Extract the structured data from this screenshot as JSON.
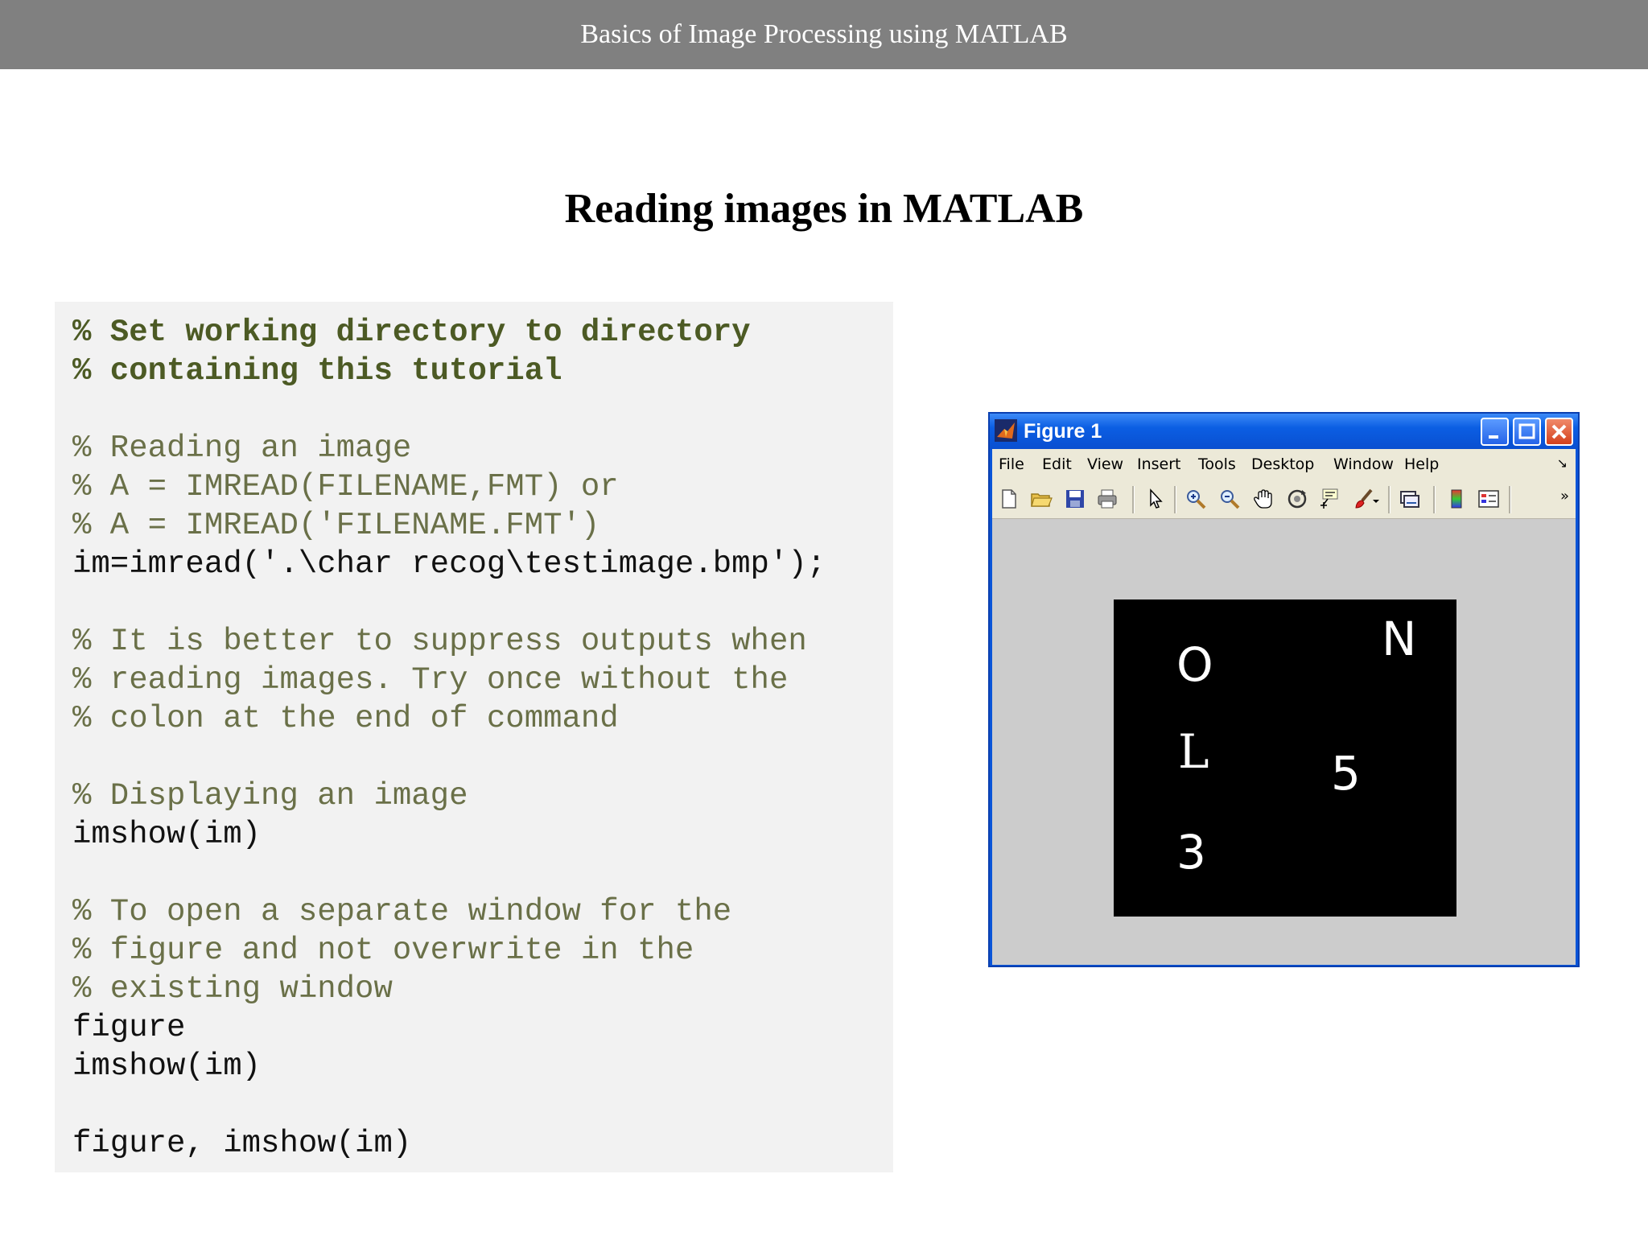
{
  "header": {
    "title": "Basics of Image Processing using MATLAB"
  },
  "slide": {
    "title": "Reading images in MATLAB"
  },
  "code_lines": [
    {
      "text": "% Set working directory to directory",
      "style": "bold-comment"
    },
    {
      "text": "% containing this tutorial",
      "style": "bold-comment"
    },
    {
      "text": "",
      "style": "blank"
    },
    {
      "text": "% Reading an image",
      "style": "comment"
    },
    {
      "text": "% A = IMREAD(FILENAME,FMT) or",
      "style": "comment"
    },
    {
      "text": "% A = IMREAD('FILENAME.FMT')",
      "style": "comment"
    },
    {
      "text": "im=imread('.\\char recog\\testimage.bmp');",
      "style": "code"
    },
    {
      "text": "",
      "style": "blank"
    },
    {
      "text": "% It is better to suppress outputs when",
      "style": "comment"
    },
    {
      "text": "% reading images. Try once without the",
      "style": "comment"
    },
    {
      "text": "% colon at the end of command",
      "style": "comment"
    },
    {
      "text": "",
      "style": "blank"
    },
    {
      "text": "% Displaying an image",
      "style": "comment"
    },
    {
      "text": "imshow(im)",
      "style": "code"
    },
    {
      "text": "",
      "style": "blank"
    },
    {
      "text": "% To open a separate window for the",
      "style": "comment"
    },
    {
      "text": "% figure and not overwrite in the",
      "style": "comment"
    },
    {
      "text": "% existing window",
      "style": "comment"
    },
    {
      "text": "figure",
      "style": "code"
    },
    {
      "text": "imshow(im)",
      "style": "code"
    },
    {
      "text": "",
      "style": "blank"
    },
    {
      "text": "figure, imshow(im)",
      "style": "code"
    }
  ],
  "figure_window": {
    "title": "Figure 1",
    "icon": "matlab-icon",
    "controls": [
      "minimize-icon",
      "maximize-icon",
      "close-icon"
    ],
    "menu": [
      "File",
      "Edit",
      "View",
      "Insert",
      "Tools",
      "Desktop",
      "Window",
      "Help"
    ],
    "toolbar_icons": [
      "new-figure-icon",
      "open-file-icon",
      "save-icon",
      "print-icon",
      "edit-plot-icon",
      "zoom-in-icon",
      "zoom-out-icon",
      "pan-icon",
      "rotate-3d-icon",
      "data-cursor-icon",
      "brush-icon",
      "link-plot-icon",
      "colorbar-icon",
      "legend-icon"
    ],
    "image_chars": [
      "O",
      "N",
      "L",
      "5",
      "3"
    ],
    "colors": {
      "titlebar": "#0b5ee3",
      "canvas": "#cccccc",
      "image_bg": "#000000"
    }
  },
  "colors": {
    "header_bg": "#808080",
    "code_bg": "#f2f2f2",
    "comment": "#6a7048",
    "bold_comment": "#4c5a24"
  }
}
